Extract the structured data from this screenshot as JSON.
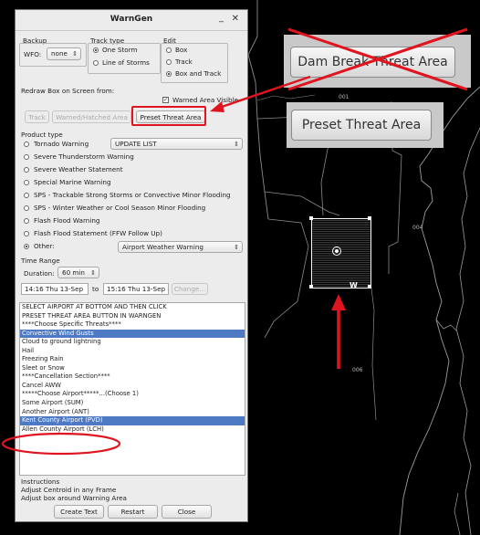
{
  "map": {
    "labels": [
      "001",
      "003",
      "004",
      "006"
    ]
  },
  "window": {
    "title": "WarnGen",
    "minimize_glyph": "_",
    "close_glyph": "✕",
    "backup": {
      "label": "Backup",
      "wfo_label": "WFO:",
      "wfo_value": "none"
    },
    "track_type": {
      "label": "Track type",
      "options": [
        "One Storm",
        "Line of Storms"
      ],
      "selected": "One Storm"
    },
    "edit": {
      "label": "Edit",
      "options": [
        "Box",
        "Track",
        "Box and Track"
      ],
      "selected": "Box and Track"
    },
    "redraw_label": "Redraw Box on Screen from:",
    "warned_area_visible": "Warned Area Visible",
    "redraw_buttons": {
      "track": "Track",
      "warned_hatched": "Warned/Hatched Area",
      "preset": "Preset Threat Area"
    },
    "product_type": {
      "label": "Product type",
      "options": [
        "Tornado Warning",
        "Severe Thunderstorm Warning",
        "Severe Weather Statement",
        "Special Marine Warning",
        "SPS - Trackable Strong Storms or Convective Minor Flooding",
        "SPS - Winter Weather or Cool Season Minor Flooding",
        "Flash Flood Warning",
        "Flash Flood Statement (FFW Follow Up)",
        "Other:"
      ],
      "selected": "Other:",
      "update_list": "UPDATE LIST",
      "other_value": "Airport Weather Warning"
    },
    "time_range": {
      "label": "Time Range",
      "duration_label": "Duration:",
      "duration_value": "60 min",
      "start": "14:16 Thu 13-Sep",
      "to": "to",
      "end": "15:16 Thu 13-Sep",
      "change": "Change..."
    },
    "list_items": [
      "SELECT AIRPORT AT BOTTOM AND THEN CLICK",
      "PRESET THREAT AREA BUTTON IN WARNGEN",
      "****Choose Specific Threats****",
      "Convective Wind Gusts",
      "Cloud to ground lightning",
      "Hail",
      "Freezing Rain",
      "Sleet or Snow",
      "****Cancellation Section****",
      "Cancel AWW",
      "*****Choose Airport*****...(Choose 1)",
      "Some Airport (SUM)",
      "Another Airport (ANT)",
      "Kent County Airport (PVD)",
      "Allen County Airport (LCH)"
    ],
    "selected_items": [
      "Convective Wind Gusts",
      "Kent County Airport (PVD)"
    ],
    "instructions": {
      "label": "Instructions",
      "lines": [
        "Adjust Centroid in any Frame",
        "Adjust box around Warning Area"
      ]
    },
    "bottom_buttons": {
      "create": "Create Text",
      "restart": "Restart",
      "close": "Close"
    }
  },
  "callouts": {
    "old_button": "Dam Break Threat Area",
    "new_button": "Preset Threat Area"
  },
  "colors": {
    "annotation_red": "#e0141e",
    "selection_blue": "#4e7ac4",
    "map_background": "#000000"
  }
}
